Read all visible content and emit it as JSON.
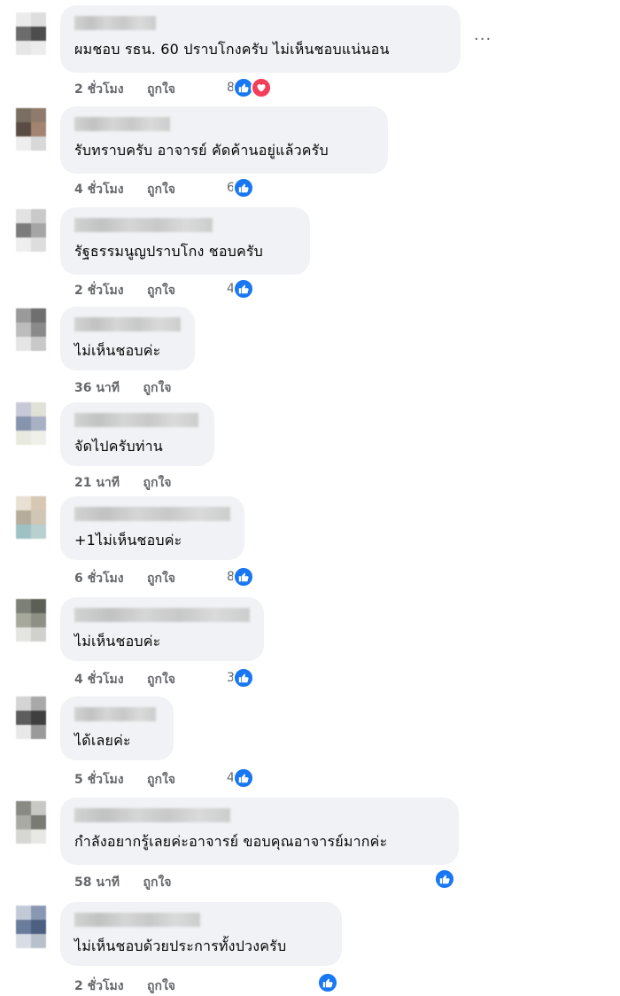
{
  "ui": {
    "more_options": "···"
  },
  "comments": [
    {
      "text": "ผมชอบ รธน. 60 ปราบโกงครับ ไม่เห็นชอบแน่นอน",
      "time": "2 ชั่วโมง",
      "like_label": "ถูกใจ",
      "reaction_count": "8",
      "reactions": [
        "like-icon",
        "love-icon"
      ]
    },
    {
      "text": "รับทราบครับ อาจารย์ คัดค้านอยู่แล้วครับ",
      "time": "4 ชั่วโมง",
      "like_label": "ถูกใจ",
      "reaction_count": "6",
      "reactions": [
        "like-icon"
      ]
    },
    {
      "text": "รัฐธรรมนูญปราบโกง ชอบครับ",
      "time": "2 ชั่วโมง",
      "like_label": "ถูกใจ",
      "reaction_count": "4",
      "reactions": [
        "like-icon"
      ]
    },
    {
      "text": "ไม่เห็นชอบค่ะ",
      "time": "36 นาที",
      "like_label": "ถูกใจ",
      "reaction_count": "",
      "reactions": []
    },
    {
      "text": "จัดไปครับท่าน",
      "time": "21 นาที",
      "like_label": "ถูกใจ",
      "reaction_count": "",
      "reactions": []
    },
    {
      "text": "+1ไม่เห็นชอบค่ะ",
      "time": "6 ชั่วโมง",
      "like_label": "ถูกใจ",
      "reaction_count": "8",
      "reactions": [
        "like-icon"
      ]
    },
    {
      "text": "ไม่เห็นชอบค่ะ",
      "time": "4 ชั่วโมง",
      "like_label": "ถูกใจ",
      "reaction_count": "3",
      "reactions": [
        "like-icon"
      ]
    },
    {
      "text": "ได้เลยค่ะ",
      "time": "5 ชั่วโมง",
      "like_label": "ถูกใจ",
      "reaction_count": "4",
      "reactions": [
        "like-icon"
      ]
    },
    {
      "text": "กำลังอยากรู้เลยค่ะอาจารย์ ขอบคุณอาจารย์มากค่ะ",
      "time": "58 นาที",
      "like_label": "ถูกใจ",
      "reaction_count": "",
      "reactions": [
        "like-icon"
      ]
    },
    {
      "text": "ไม่เห็นชอบด้วยประการทั้งปวงครับ",
      "time": "2 ชั่วโมง",
      "like_label": "ถูกใจ",
      "reaction_count": "",
      "reactions": [
        "like-icon"
      ]
    }
  ],
  "colors": {
    "bubble": "#f0f2f5",
    "meta_text": "#65676b",
    "like_blue": "#1877f2",
    "love_red": "#f33e58"
  }
}
